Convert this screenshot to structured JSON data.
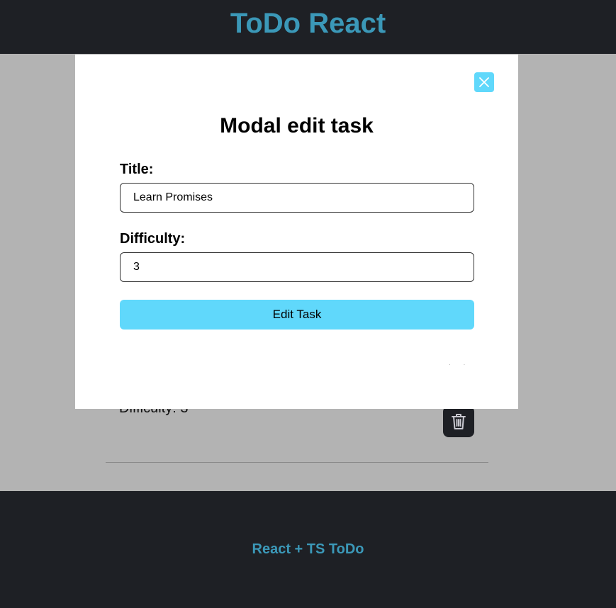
{
  "header": {
    "title": "ToDo React"
  },
  "background_task": {
    "difficulty_text": "Difficulty: 3"
  },
  "modal": {
    "title": "Modal edit task",
    "title_label": "Title:",
    "title_value": "Learn Promises",
    "difficulty_label": "Difficulty:",
    "difficulty_value": "3",
    "submit_label": "Edit Task"
  },
  "footer": {
    "text": "React + TS ToDo"
  },
  "colors": {
    "accent": "#60d8fb",
    "brand": "#3b98b8",
    "dark": "#1e2025",
    "overlay": "#b3b3b3"
  },
  "icons": {
    "close": "close-icon",
    "delete": "trash-icon"
  }
}
